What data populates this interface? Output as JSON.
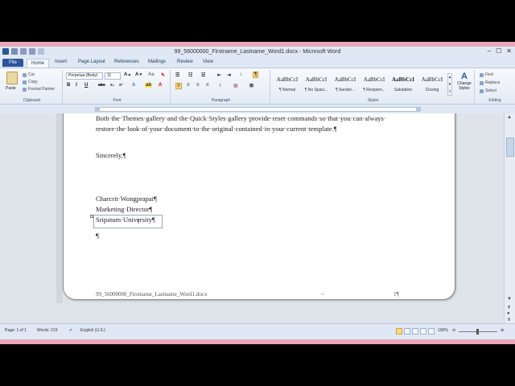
{
  "window": {
    "title": "99_56000000_Firstname_Lastname_Word1.docx - Microsoft Word",
    "controls": [
      "–",
      "☐",
      "✕"
    ]
  },
  "tabs": [
    "File",
    "Home",
    "Insert",
    "Page Layout",
    "References",
    "Mailings",
    "Review",
    "View"
  ],
  "clipboard": {
    "paste": "Paste",
    "cut": "Cut",
    "copy": "Copy",
    "format_painter": "Format Painter",
    "label": "Clipboard"
  },
  "font": {
    "name": "Perpetua (Body)",
    "size": "11",
    "label": "Font"
  },
  "paragraph": {
    "label": "Paragraph"
  },
  "styles": {
    "items": [
      {
        "sample": "AaBbCcI",
        "name": "¶ Normal"
      },
      {
        "sample": "AaBbCcI",
        "name": "¶ No Spaci..."
      },
      {
        "sample": "AaBbCcI",
        "name": "¶ Sender..."
      },
      {
        "sample": "AaBbCcI",
        "name": "¶ Recipien..."
      },
      {
        "sample": "AaBbCcI",
        "name": "Salutation"
      },
      {
        "sample": "AaBbCcI",
        "name": "Closing"
      }
    ],
    "change_styles": "Change Styles",
    "label": "Styles"
  },
  "editing": {
    "find": "Find",
    "replace": "Replace",
    "select": "Select",
    "label": "Editing"
  },
  "document": {
    "line1": "Both·the·Themes·gallery·and·the·Quick·Styles·gallery·provide·reset·commands·so·that·you·can·always·",
    "line2": "restore·the·look·of·your·document·to·the·original·contained·in·your·current·template.¶",
    "closing": "Sincerely,¶",
    "name": "Charcrit·Wongprapai¶",
    "title": "Marketing·Director¶",
    "org": "Sripatum·University¶",
    "empty_para": "¶",
    "footer_file": "99_56000000_Firstname_Lastname_Word1.docx",
    "footer_arrow": "→",
    "footer_page": "1¶"
  },
  "status": {
    "page": "Page: 1 of 1",
    "words": "Words: 215",
    "language": "English (U.S.)",
    "zoom": "100%"
  }
}
